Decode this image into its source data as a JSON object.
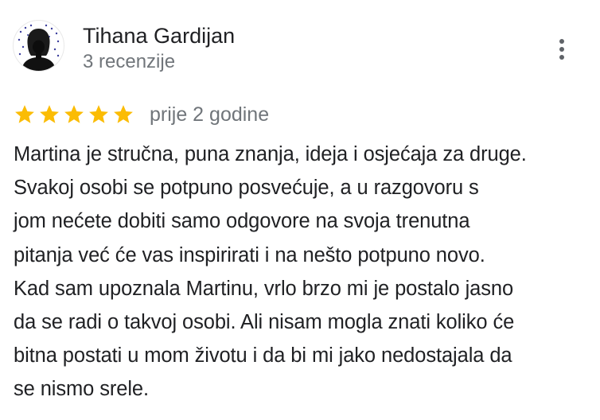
{
  "review": {
    "author": {
      "name": "Tihana Gardijan",
      "review_count": "3 recenzije",
      "avatar_icon": "avatar-silhouette-rain"
    },
    "more_options_icon": "more-vert-icon",
    "rating": {
      "stars": 5,
      "max_stars": 5,
      "star_color": "#fbbc04"
    },
    "date": "prije 2 godine",
    "text": "Martina je stručna, puna znanja, ideja i osjećaja za druge.\nSvakoj osobi se potpuno posvećuje, a u razgovoru s\njom nećete dobiti samo odgovore na svoja trenutna\npitanja već će vas inspirirati i na nešto potpuno novo.\nKad sam upoznala Martinu, vrlo brzo mi je postalo jasno\nda se radi o takvoj osobi. Ali nisam mogla znati koliko će\nbitna postati u mom životu i da bi mi jako nedostajala da\nse nismo srele."
  }
}
